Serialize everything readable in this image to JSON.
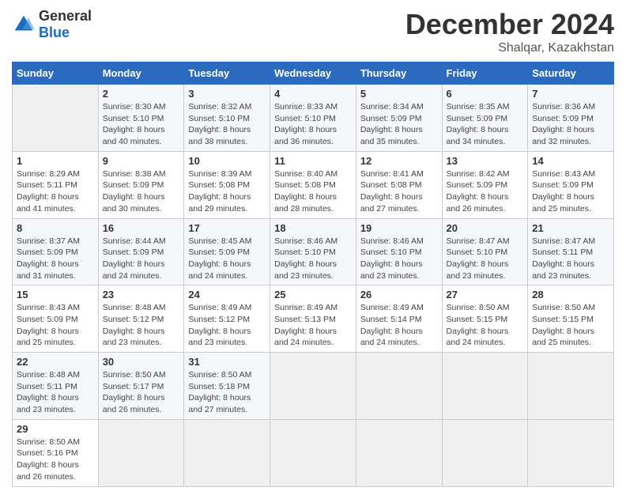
{
  "header": {
    "logo": {
      "general": "General",
      "blue": "Blue"
    },
    "title": "December 2024",
    "subtitle": "Shalqar, Kazakhstan"
  },
  "calendar": {
    "days_of_week": [
      "Sunday",
      "Monday",
      "Tuesday",
      "Wednesday",
      "Thursday",
      "Friday",
      "Saturday"
    ],
    "weeks": [
      [
        {
          "day": "",
          "info": ""
        },
        {
          "day": "2",
          "info": "Sunrise: 8:30 AM\nSunset: 5:10 PM\nDaylight: 8 hours\nand 40 minutes."
        },
        {
          "day": "3",
          "info": "Sunrise: 8:32 AM\nSunset: 5:10 PM\nDaylight: 8 hours\nand 38 minutes."
        },
        {
          "day": "4",
          "info": "Sunrise: 8:33 AM\nSunset: 5:10 PM\nDaylight: 8 hours\nand 36 minutes."
        },
        {
          "day": "5",
          "info": "Sunrise: 8:34 AM\nSunset: 5:09 PM\nDaylight: 8 hours\nand 35 minutes."
        },
        {
          "day": "6",
          "info": "Sunrise: 8:35 AM\nSunset: 5:09 PM\nDaylight: 8 hours\nand 34 minutes."
        },
        {
          "day": "7",
          "info": "Sunrise: 8:36 AM\nSunset: 5:09 PM\nDaylight: 8 hours\nand 32 minutes."
        }
      ],
      [
        {
          "day": "1",
          "info": "Sunrise: 8:29 AM\nSunset: 5:11 PM\nDaylight: 8 hours\nand 41 minutes."
        },
        {
          "day": "9",
          "info": "Sunrise: 8:38 AM\nSunset: 5:09 PM\nDaylight: 8 hours\nand 30 minutes."
        },
        {
          "day": "10",
          "info": "Sunrise: 8:39 AM\nSunset: 5:08 PM\nDaylight: 8 hours\nand 29 minutes."
        },
        {
          "day": "11",
          "info": "Sunrise: 8:40 AM\nSunset: 5:08 PM\nDaylight: 8 hours\nand 28 minutes."
        },
        {
          "day": "12",
          "info": "Sunrise: 8:41 AM\nSunset: 5:08 PM\nDaylight: 8 hours\nand 27 minutes."
        },
        {
          "day": "13",
          "info": "Sunrise: 8:42 AM\nSunset: 5:09 PM\nDaylight: 8 hours\nand 26 minutes."
        },
        {
          "day": "14",
          "info": "Sunrise: 8:43 AM\nSunset: 5:09 PM\nDaylight: 8 hours\nand 25 minutes."
        }
      ],
      [
        {
          "day": "8",
          "info": "Sunrise: 8:37 AM\nSunset: 5:09 PM\nDaylight: 8 hours\nand 31 minutes."
        },
        {
          "day": "16",
          "info": "Sunrise: 8:44 AM\nSunset: 5:09 PM\nDaylight: 8 hours\nand 24 minutes."
        },
        {
          "day": "17",
          "info": "Sunrise: 8:45 AM\nSunset: 5:09 PM\nDaylight: 8 hours\nand 24 minutes."
        },
        {
          "day": "18",
          "info": "Sunrise: 8:46 AM\nSunset: 5:10 PM\nDaylight: 8 hours\nand 23 minutes."
        },
        {
          "day": "19",
          "info": "Sunrise: 8:46 AM\nSunset: 5:10 PM\nDaylight: 8 hours\nand 23 minutes."
        },
        {
          "day": "20",
          "info": "Sunrise: 8:47 AM\nSunset: 5:10 PM\nDaylight: 8 hours\nand 23 minutes."
        },
        {
          "day": "21",
          "info": "Sunrise: 8:47 AM\nSunset: 5:11 PM\nDaylight: 8 hours\nand 23 minutes."
        }
      ],
      [
        {
          "day": "15",
          "info": "Sunrise: 8:43 AM\nSunset: 5:09 PM\nDaylight: 8 hours\nand 25 minutes."
        },
        {
          "day": "23",
          "info": "Sunrise: 8:48 AM\nSunset: 5:12 PM\nDaylight: 8 hours\nand 23 minutes."
        },
        {
          "day": "24",
          "info": "Sunrise: 8:49 AM\nSunset: 5:12 PM\nDaylight: 8 hours\nand 23 minutes."
        },
        {
          "day": "25",
          "info": "Sunrise: 8:49 AM\nSunset: 5:13 PM\nDaylight: 8 hours\nand 24 minutes."
        },
        {
          "day": "26",
          "info": "Sunrise: 8:49 AM\nSunset: 5:14 PM\nDaylight: 8 hours\nand 24 minutes."
        },
        {
          "day": "27",
          "info": "Sunrise: 8:50 AM\nSunset: 5:15 PM\nDaylight: 8 hours\nand 24 minutes."
        },
        {
          "day": "28",
          "info": "Sunrise: 8:50 AM\nSunset: 5:15 PM\nDaylight: 8 hours\nand 25 minutes."
        }
      ],
      [
        {
          "day": "22",
          "info": "Sunrise: 8:48 AM\nSunset: 5:11 PM\nDaylight: 8 hours\nand 23 minutes."
        },
        {
          "day": "30",
          "info": "Sunrise: 8:50 AM\nSunset: 5:17 PM\nDaylight: 8 hours\nand 26 minutes."
        },
        {
          "day": "31",
          "info": "Sunrise: 8:50 AM\nSunset: 5:18 PM\nDaylight: 8 hours\nand 27 minutes."
        },
        {
          "day": "",
          "info": ""
        },
        {
          "day": "",
          "info": ""
        },
        {
          "day": "",
          "info": ""
        },
        {
          "day": "",
          "info": ""
        }
      ],
      [
        {
          "day": "29",
          "info": "Sunrise: 8:50 AM\nSunset: 5:16 PM\nDaylight: 8 hours\nand 26 minutes."
        },
        {
          "day": "",
          "info": ""
        },
        {
          "day": "",
          "info": ""
        },
        {
          "day": "",
          "info": ""
        },
        {
          "day": "",
          "info": ""
        },
        {
          "day": "",
          "info": ""
        },
        {
          "day": "",
          "info": ""
        }
      ]
    ]
  }
}
